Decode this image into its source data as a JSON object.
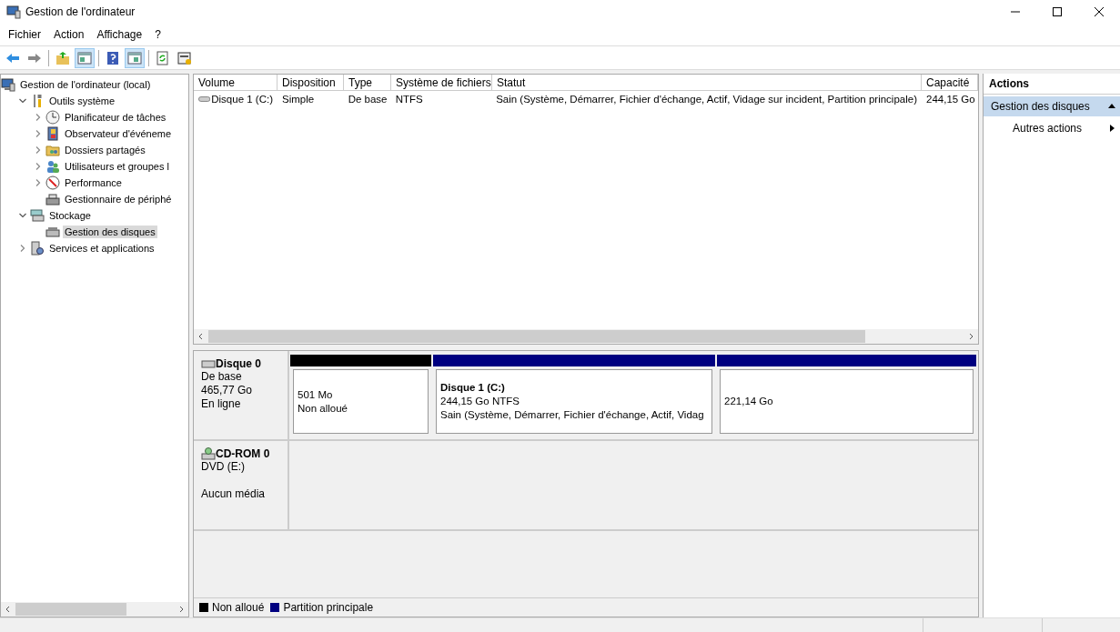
{
  "window": {
    "title": "Gestion de l'ordinateur"
  },
  "menu": [
    "Fichier",
    "Action",
    "Affichage",
    "?"
  ],
  "toolbar": [
    {
      "pressed": false
    },
    {
      "pressed": false
    },
    {
      "pressed": false
    },
    {
      "pressed": true
    },
    {
      "pressed": false
    },
    {
      "pressed": true
    },
    {
      "pressed": false
    },
    {
      "pressed": false
    }
  ],
  "tree": [
    {
      "label": "Gestion de l'ordinateur (local)",
      "kind": "root",
      "selected": false,
      "children": [
        {
          "label": "Outils système",
          "kind": "branch",
          "expanded": true,
          "selected": false,
          "children": [
            {
              "label": "Planificateur de tâches",
              "kind": "branch",
              "expanded": false,
              "selected": false
            },
            {
              "label": "Observateur d'événeme",
              "kind": "branch",
              "expanded": false,
              "selected": false
            },
            {
              "label": "Dossiers partagés",
              "kind": "branch",
              "expanded": false,
              "selected": false
            },
            {
              "label": "Utilisateurs et groupes l",
              "kind": "branch",
              "expanded": false,
              "selected": false
            },
            {
              "label": "Performance",
              "kind": "branch",
              "expanded": false,
              "selected": false
            },
            {
              "label": "Gestionnaire de périphé",
              "kind": "leaf",
              "selected": false
            }
          ]
        },
        {
          "label": "Stockage",
          "kind": "branch",
          "expanded": true,
          "selected": false,
          "children": [
            {
              "label": "Gestion des disques",
              "kind": "leaf",
              "selected": true
            }
          ]
        },
        {
          "label": "Services et applications",
          "kind": "branch",
          "expanded": false,
          "selected": false
        }
      ]
    }
  ],
  "table": {
    "columns": [
      "Volume",
      "Disposition",
      "Type",
      "Système de fichiers",
      "Statut",
      "Capacité"
    ],
    "rows": [
      {
        "cells": [
          "Disque 1 (C:)",
          "Simple",
          "De base",
          "NTFS",
          "Sain (Système, Démarrer, Fichier d'échange, Actif, Vidage sur incident, Partition principale)",
          "244,15 Go"
        ]
      }
    ]
  },
  "disks": [
    {
      "name": "Disque 0",
      "kind": "disk",
      "type": "De base",
      "size": "465,77 Go",
      "status": "En ligne",
      "partitions": [
        {
          "color": "#000000",
          "lines": [
            "501 Mo",
            "Non alloué"
          ]
        },
        {
          "color": "#000080",
          "name": "Disque 1  (C:)",
          "lines": [
            "244,15 Go NTFS",
            "Sain (Système, Démarrer, Fichier d'échange, Actif, Vidag"
          ]
        },
        {
          "color": "#000080",
          "lines": [
            "221,14 Go"
          ]
        }
      ]
    },
    {
      "name": "CD-ROM 0",
      "kind": "cdrom",
      "type": "DVD (E:)",
      "status": "Aucun média"
    }
  ],
  "legend": [
    {
      "label": "Non alloué",
      "color": "#000000"
    },
    {
      "label": "Partition principale",
      "color": "#000080"
    }
  ],
  "actions": {
    "title": "Actions",
    "sections": [
      {
        "label": "Gestion des disques",
        "expanded": true,
        "items": [
          "Autres actions"
        ]
      }
    ]
  }
}
